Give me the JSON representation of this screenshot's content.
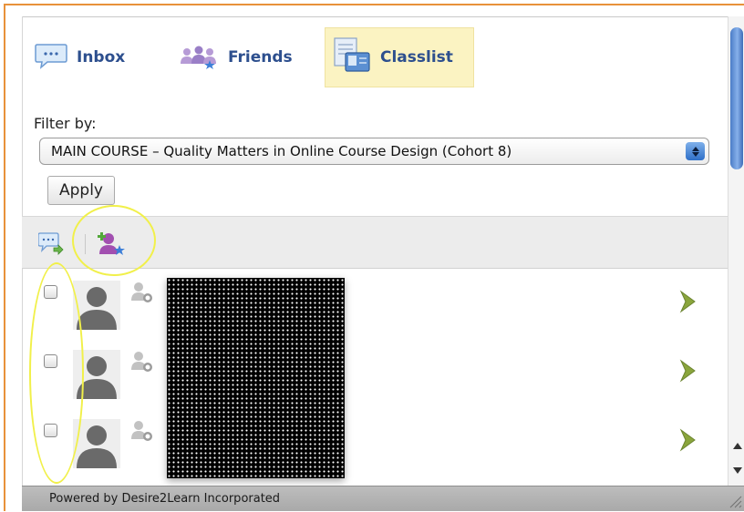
{
  "tabs": [
    {
      "label": "Inbox",
      "icon": "speech-bubble-icon"
    },
    {
      "label": "Friends",
      "icon": "people-icon"
    },
    {
      "label": "Classlist",
      "icon": "classlist-icon",
      "selected": true
    }
  ],
  "filter": {
    "label": "Filter by:",
    "selected": "MAIN COURSE – Quality Matters in Online Course Design (Cohort 8)",
    "apply_label": "Apply"
  },
  "toolbar": {
    "icons": [
      "send-message-icon",
      "add-friend-icon"
    ]
  },
  "rows": [
    {
      "checked": false
    },
    {
      "checked": false
    },
    {
      "checked": false
    }
  ],
  "footer": {
    "text": "Powered by Desire2Learn Incorporated"
  },
  "colors": {
    "tab_text": "#2d4f8e",
    "selected_tab_bg": "#fbf3c2",
    "highlight": "#f1f04a",
    "frame_border": "#e8913a",
    "chevron": "#8aa53c"
  }
}
